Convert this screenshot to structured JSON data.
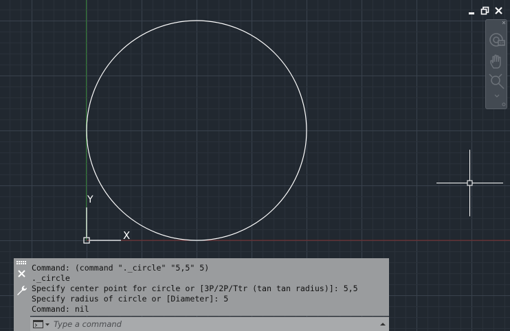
{
  "colors": {
    "background": "#212830",
    "grid_minor": "#2a313a",
    "grid_major": "#39424d",
    "x_axis": "#7a2a2a",
    "y_axis": "#2e7a2e",
    "entity": "#ffffff",
    "command_bg": "#9a9c9e",
    "command_text": "#111111"
  },
  "drawing": {
    "circle": {
      "center": [
        5,
        5
      ],
      "radius": 5
    },
    "ucs_x_label": "X",
    "ucs_y_label": "Y"
  },
  "icons": {
    "window_minimize": "minimize-icon",
    "window_restore": "restore-icon",
    "window_close": "close-icon",
    "full_navigation_wheel": "steering-wheel-icon",
    "pan": "pan-hand-icon",
    "zoom_extents": "zoom-extents-icon",
    "navbar_close": "close-icon",
    "navbar_options": "chevron-down-icon",
    "command_close": "close-icon",
    "command_customize": "wrench-icon",
    "command_prompt": "command-prompt-icon"
  },
  "command_line": {
    "history": [
      "Command: (command \"._circle\" \"5,5\" 5)",
      "._circle",
      "Specify center point for circle or [3P/2P/Ttr (tan tan radius)]: 5,5",
      "Specify radius of circle or [Diameter]: 5",
      "Command: nil"
    ],
    "input_value": "",
    "input_placeholder": "Type a command"
  }
}
